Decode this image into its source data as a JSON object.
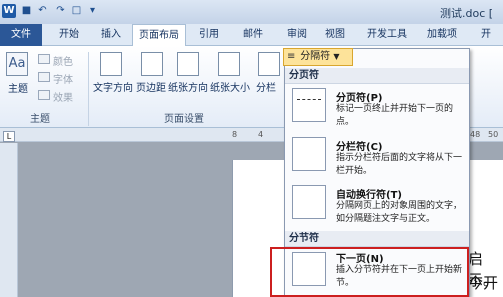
{
  "title_bar": {
    "doc_title": "测试.doc [",
    "app_icon": "W"
  },
  "tabs": [
    "文件",
    "开始",
    "插入",
    "页面布局",
    "引用",
    "邮件",
    "审阅",
    "视图",
    "开发工具",
    "加载项",
    "开"
  ],
  "ribbon": {
    "themes": {
      "big_label": "主题",
      "colors": "颜色",
      "fonts": "字体",
      "effects": "效果",
      "group": "主题"
    },
    "page_setup": {
      "buttons": [
        "文字方向",
        "页边距",
        "纸张方向",
        "纸张大小",
        "分栏"
      ],
      "group": "页面设置"
    },
    "breaks_button": "分隔符"
  },
  "ruler": {
    "corner": "L",
    "ticks": [
      "8",
      "4",
      "48",
      "50"
    ]
  },
  "menu": {
    "section_page": "分页符",
    "section_section": "分节符",
    "items": [
      {
        "title": "分页符(P)",
        "desc": "标记一页终止并开始下一页的点。"
      },
      {
        "title": "分栏符(C)",
        "desc": "指示分栏符后面的文字将从下一栏开始。"
      },
      {
        "title": "自动换行符(T)",
        "desc": "分隔网页上的对象周围的文字，如分隔题注文字与正文。"
      },
      {
        "title": "下一页(N)",
        "desc": "插入分节符并在下一页上开始新节。"
      }
    ]
  },
  "document": {
    "line1": "启示。",
    "line2": "今开"
  },
  "colors": {
    "file_tab": "#2b5797",
    "highlight": "#cc1f1f",
    "breaks_button": "#fde39a"
  }
}
